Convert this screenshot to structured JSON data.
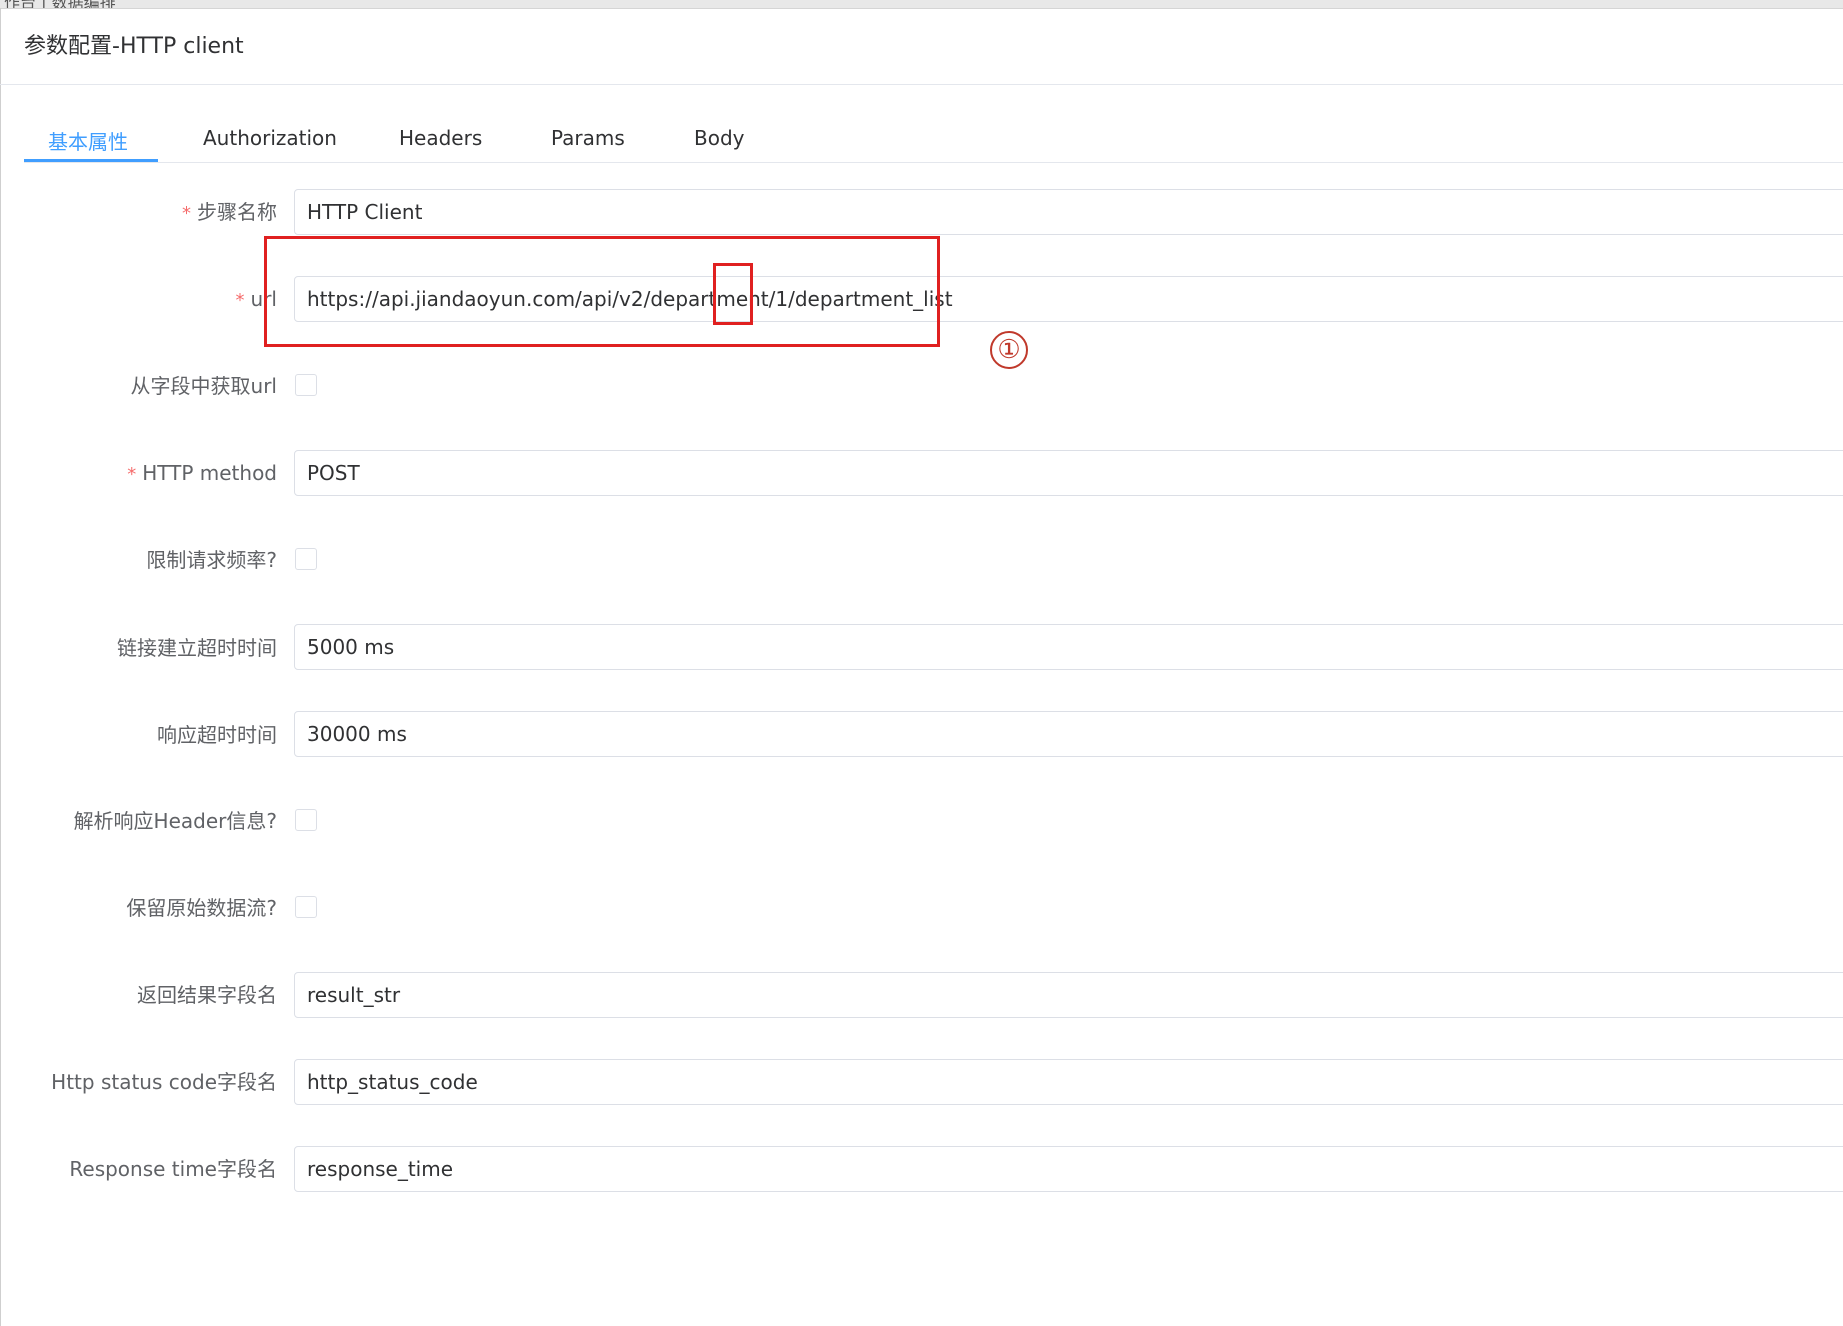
{
  "top_bar": {
    "crumb": "作台 | 数据编排"
  },
  "dialog": {
    "title": "参数配置-HTTP client"
  },
  "tabs": [
    {
      "label": "基本属性",
      "active": true
    },
    {
      "label": "Authorization"
    },
    {
      "label": "Headers"
    },
    {
      "label": "Params"
    },
    {
      "label": "Body"
    }
  ],
  "form": {
    "step_name": {
      "label": "步骤名称",
      "required": true,
      "value": "HTTP Client"
    },
    "url": {
      "label": "url",
      "required": true,
      "value": "https://api.jiandaoyun.com/api/v2/department/1/department_list"
    },
    "url_from_field": {
      "label": "从字段中获取url",
      "checked": false
    },
    "http_method": {
      "label": "HTTP method",
      "required": true,
      "value": "POST"
    },
    "limit_rate": {
      "label": "限制请求频率?",
      "checked": false
    },
    "connect_timeout": {
      "label": "链接建立超时时间",
      "value": "5000 ms"
    },
    "response_timeout": {
      "label": "响应超时时间",
      "value": "30000 ms"
    },
    "parse_headers": {
      "label": "解析响应Header信息?",
      "checked": false
    },
    "keep_raw_stream": {
      "label": "保留原始数据流?",
      "checked": false
    },
    "result_field": {
      "label": "返回结果字段名",
      "value": "result_str"
    },
    "status_code_field": {
      "label": "Http status code字段名",
      "value": "http_status_code"
    },
    "response_time_field": {
      "label": "Response time字段名",
      "value": "response_time"
    }
  },
  "annotation": {
    "marker": "①"
  },
  "colors": {
    "accent": "#409eff",
    "required": "#f56c6c",
    "annotation": "#e02020"
  }
}
